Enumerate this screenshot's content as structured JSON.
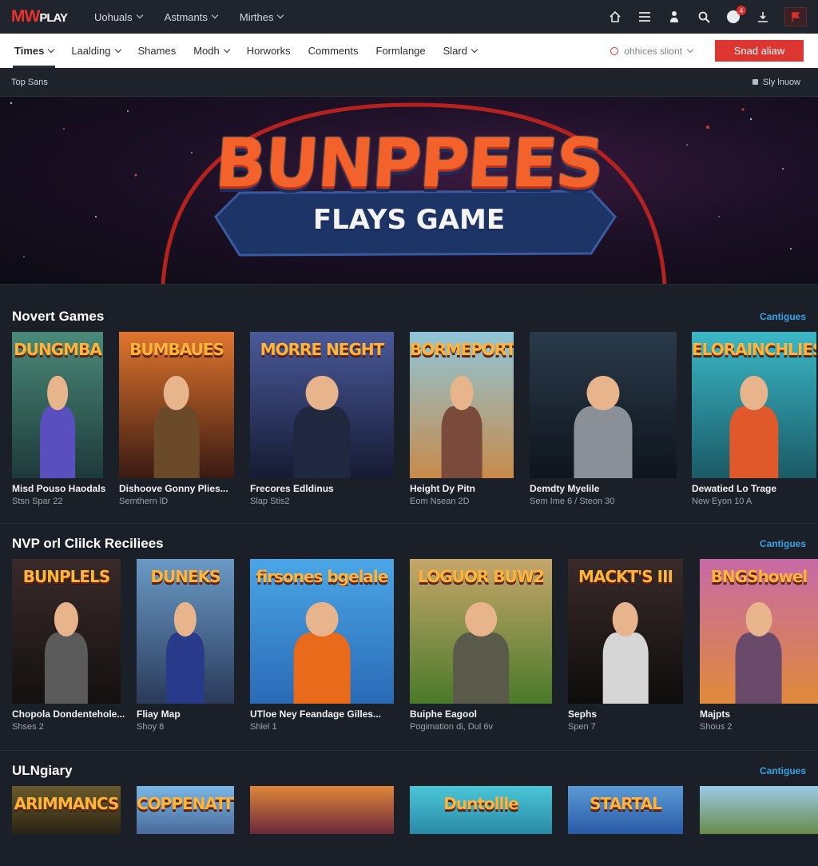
{
  "app": {
    "logo_red": "MW",
    "logo_white": "PLAY"
  },
  "topnav": [
    {
      "label": "Uohuals"
    },
    {
      "label": "Astmants"
    },
    {
      "label": "Mirthes"
    }
  ],
  "topicons": {
    "notification_count": "4"
  },
  "subnav": {
    "tabs": [
      {
        "label": "Times",
        "dropdown": true,
        "active": true
      },
      {
        "label": "Laalding",
        "dropdown": true
      },
      {
        "label": "Shames",
        "dropdown": false
      },
      {
        "label": "Modh",
        "dropdown": true
      },
      {
        "label": "Horworks",
        "dropdown": false
      },
      {
        "label": "Comments",
        "dropdown": false
      },
      {
        "label": "Formlange",
        "dropdown": false
      },
      {
        "label": "Slard",
        "dropdown": true
      }
    ],
    "filter_label": "ohhices sliont",
    "cta_label": "Snad aliaw"
  },
  "crumb": {
    "left": "Top Sans",
    "right": "Sly lnuow"
  },
  "banner": {
    "title": "BUNPPEES",
    "subtitle": "FLAYS GAME"
  },
  "sections": [
    {
      "title": "Novert Games",
      "link": "Cantigues",
      "cards": [
        {
          "thumb_title": "DUNGMBA",
          "name": "Misd Pouso Haodals",
          "meta": "Stsn Spar 22",
          "bg": [
            "#4a8a78",
            "#1e3a3a"
          ],
          "accent": "#5a4fbf"
        },
        {
          "thumb_title": "BUMBAUES",
          "name": "Dishoove Gonny Plies...",
          "meta": "Semthern lD",
          "bg": [
            "#e0752e",
            "#3a1a12"
          ],
          "accent": "#6b4a2a"
        },
        {
          "thumb_title": "MORRE NEGHT",
          "name": "Frecores Edldinus",
          "meta": "Slap Stis2",
          "bg": [
            "#4a5a9a",
            "#151a33"
          ],
          "accent": "#202840"
        },
        {
          "thumb_title": "BORMEPORTS",
          "name": "Height Dy Pitn",
          "meta": "Eom Nsean 2D",
          "bg": [
            "#8ec6d9",
            "#c78a4a"
          ],
          "accent": "#7a4a3a"
        },
        {
          "thumb_title": "",
          "name": "Demdty Myelile",
          "meta": "Sem Ime 6 / Steon 30",
          "bg": [
            "#2a3a4a",
            "#0e141c"
          ],
          "accent": "#8a8f98"
        },
        {
          "thumb_title": "ELORAINCHLIES",
          "name": "Dewatied Lo Trage",
          "meta": "New Eyon 10 A",
          "bg": [
            "#3ab8c6",
            "#1a5a66"
          ],
          "accent": "#e0592a"
        }
      ]
    },
    {
      "title": "NVP orl Clilck Reciliees",
      "link": "Cantigues",
      "cards": [
        {
          "thumb_title": "BUNPLELS",
          "name": "Chopola Dondentehole...",
          "meta": "Shses 2",
          "bg": [
            "#3a2a2a",
            "#141010"
          ],
          "accent": "#5a5a5a"
        },
        {
          "thumb_title": "DUNEKS",
          "name": "Fliay Map",
          "meta": "Shoy 8",
          "bg": [
            "#6a9ac6",
            "#2a3a5a"
          ],
          "accent": "#2a3a8a"
        },
        {
          "thumb_title": "firsones bgelale",
          "name": "UTloe Ney Feandage Gilles...",
          "meta": "Shlel 1",
          "bg": [
            "#4aa6e6",
            "#2a6ab6"
          ],
          "accent": "#e86a1a"
        },
        {
          "thumb_title": "LOGUOR BUW2",
          "name": "Buiphe Eagool",
          "meta": "Pogimation di, Dul 6v",
          "bg": [
            "#c6a66a",
            "#4a7a2a"
          ],
          "accent": "#5a5a4a"
        },
        {
          "thumb_title": "MACKT'S III",
          "name": "Sephs",
          "meta": "Spen 7",
          "bg": [
            "#3a2a2a",
            "#0e0c0c"
          ],
          "accent": "#d6d6d6"
        },
        {
          "thumb_title": "BNGShowel",
          "name": "Majpts",
          "meta": "Shous 2",
          "bg": [
            "#c66aa6",
            "#e08a3a"
          ],
          "accent": "#6a4a6a"
        }
      ]
    },
    {
      "title": "ULNgiary",
      "link": "Cantigues",
      "cards": [
        {
          "thumb_title": "ARIMMANCS",
          "name": "",
          "meta": "",
          "bg": [
            "#6a5a2a",
            "#2a2414"
          ],
          "accent": "#5a4a2a"
        },
        {
          "thumb_title": "COPPENATITY",
          "name": "",
          "meta": "",
          "bg": [
            "#7ab6e6",
            "#4a6a9a"
          ],
          "accent": "#3a5a8a"
        },
        {
          "thumb_title": "",
          "name": "",
          "meta": "",
          "bg": [
            "#e0863a",
            "#6a2a3a"
          ],
          "accent": "#4a2a4a"
        },
        {
          "thumb_title": "Duntollle",
          "name": "",
          "meta": "",
          "bg": [
            "#4ac6d6",
            "#2a8aa6"
          ],
          "accent": "#1a6a8a"
        },
        {
          "thumb_title": "STARTAL",
          "name": "",
          "meta": "",
          "bg": [
            "#5a9ad6",
            "#2a5aa6"
          ],
          "accent": "#e0b62a"
        },
        {
          "thumb_title": "",
          "name": "",
          "meta": "",
          "bg": [
            "#9acbe6",
            "#6a8a4a"
          ],
          "accent": "#8a5a2a"
        }
      ]
    }
  ]
}
